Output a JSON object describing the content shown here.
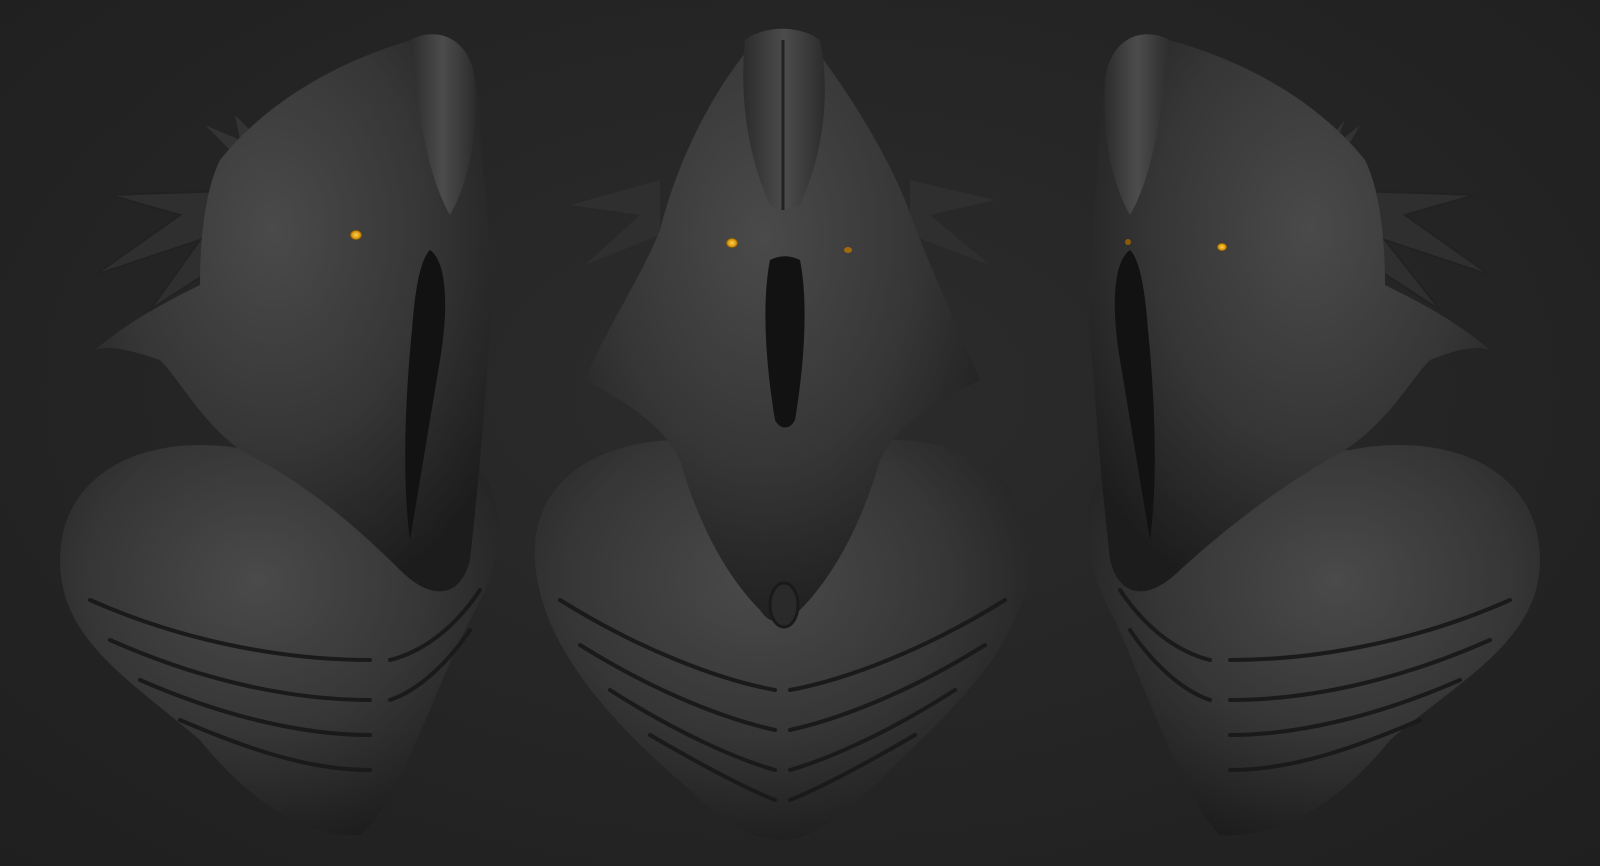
{
  "scene": {
    "background_color": "#232323",
    "sculpt_color": "#3a3a3a",
    "eye_color": "#f2b51c",
    "views": [
      {
        "name": "three-quarter-left-view"
      },
      {
        "name": "front-view"
      },
      {
        "name": "three-quarter-right-view"
      }
    ]
  }
}
